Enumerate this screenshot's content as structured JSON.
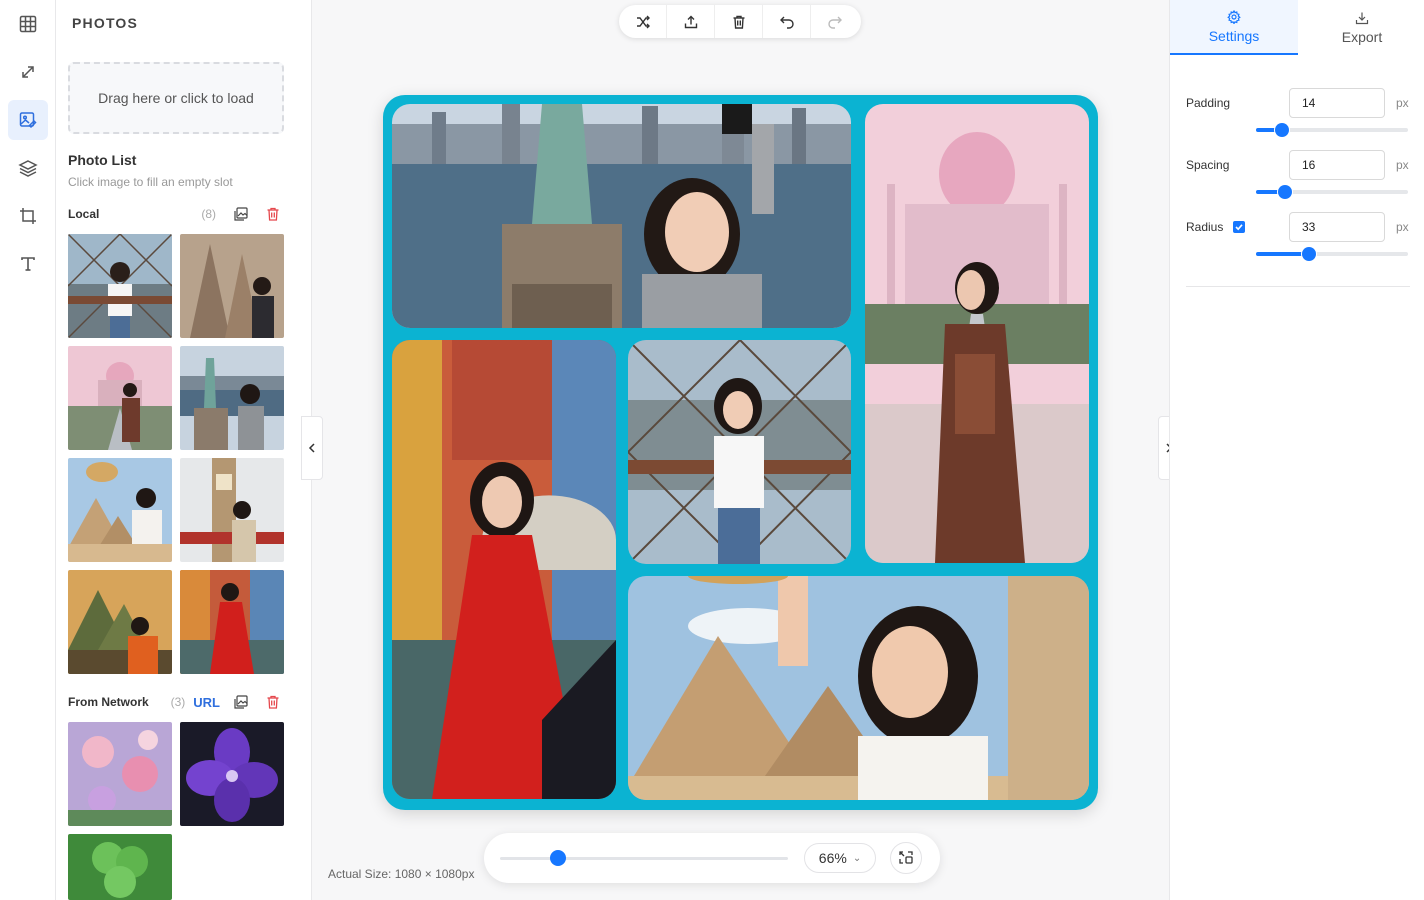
{
  "rail": {
    "items": [
      {
        "name": "layout",
        "icon": "grid-icon"
      },
      {
        "name": "resize",
        "icon": "expand-icon"
      },
      {
        "name": "photos",
        "icon": "image-edit-icon",
        "active": true
      },
      {
        "name": "layers",
        "icon": "layers-icon"
      },
      {
        "name": "crop",
        "icon": "crop-icon"
      },
      {
        "name": "text",
        "icon": "text-icon"
      }
    ]
  },
  "panel": {
    "title": "PHOTOS",
    "dropzone_label": "Drag here or click to load",
    "photo_list_title": "Photo List",
    "photo_list_hint": "Click image to fill an empty slot",
    "local": {
      "label": "Local",
      "count": "(8)"
    },
    "network": {
      "label": "From Network",
      "count": "(3)",
      "url_label": "URL"
    }
  },
  "toolbar": {
    "buttons": [
      "shuffle-icon",
      "upload-icon",
      "trash-icon",
      "undo-icon",
      "redo-icon"
    ]
  },
  "canvas": {
    "background": "#0bb3d2",
    "actual_size": "Actual Size: 1080 × 1080px"
  },
  "zoom": {
    "value": 0.2,
    "label": "66%"
  },
  "settings": {
    "tabs": [
      {
        "label": "Settings",
        "icon": "gear-icon",
        "active": true
      },
      {
        "label": "Export",
        "icon": "download-icon",
        "active": false
      }
    ],
    "padding": {
      "label": "Padding",
      "value": "14",
      "unit": "px",
      "fraction": 0.17
    },
    "spacing": {
      "label": "Spacing",
      "value": "16",
      "unit": "px",
      "fraction": 0.19
    },
    "radius": {
      "label": "Radius",
      "value": "33",
      "unit": "px",
      "fraction": 0.35,
      "enabled": true
    }
  },
  "colors": {
    "accent": "#1677ff",
    "delete": "#e5484d"
  }
}
